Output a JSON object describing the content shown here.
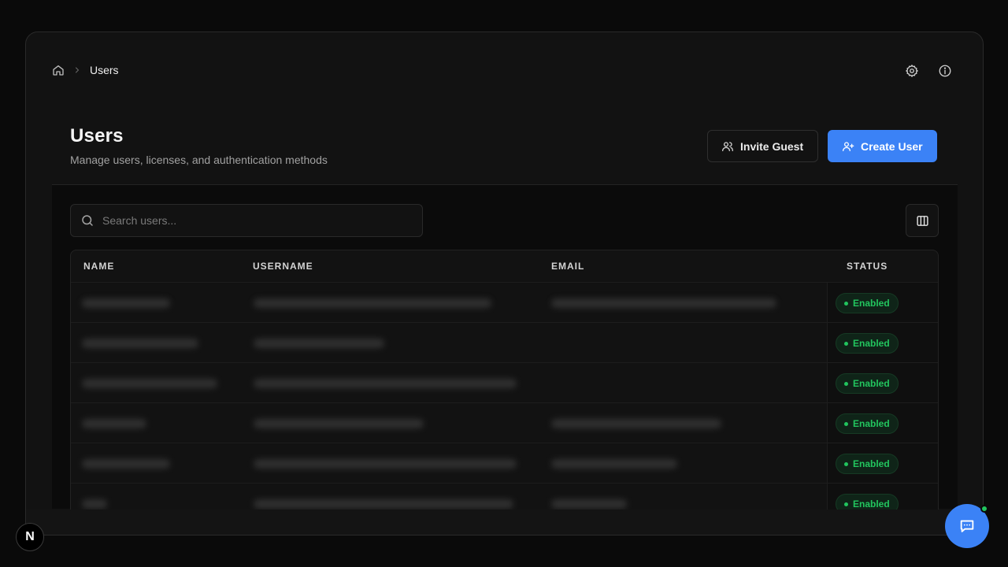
{
  "breadcrumb": {
    "home_icon": "home-icon",
    "current": "Users"
  },
  "top_icons": [
    "gear-icon",
    "info-icon"
  ],
  "header": {
    "title": "Users",
    "subtitle": "Manage users, licenses, and authentication methods"
  },
  "actions": {
    "invite_label": "Invite Guest",
    "create_label": "Create User"
  },
  "search": {
    "placeholder": "Search users..."
  },
  "table": {
    "columns": [
      "NAME",
      "USERNAME",
      "EMAIL",
      "STATUS"
    ],
    "rows": [
      {
        "status": "Enabled"
      },
      {
        "status": "Enabled"
      },
      {
        "status": "Enabled"
      },
      {
        "status": "Enabled"
      },
      {
        "status": "Enabled"
      },
      {
        "status": "Enabled"
      }
    ]
  },
  "colors": {
    "accent": "#3b82f6",
    "status_enabled": "#22c55e",
    "background": "#0a0a0a"
  },
  "floating": {
    "framework_badge": "N",
    "chat_icon": "chat-icon"
  }
}
